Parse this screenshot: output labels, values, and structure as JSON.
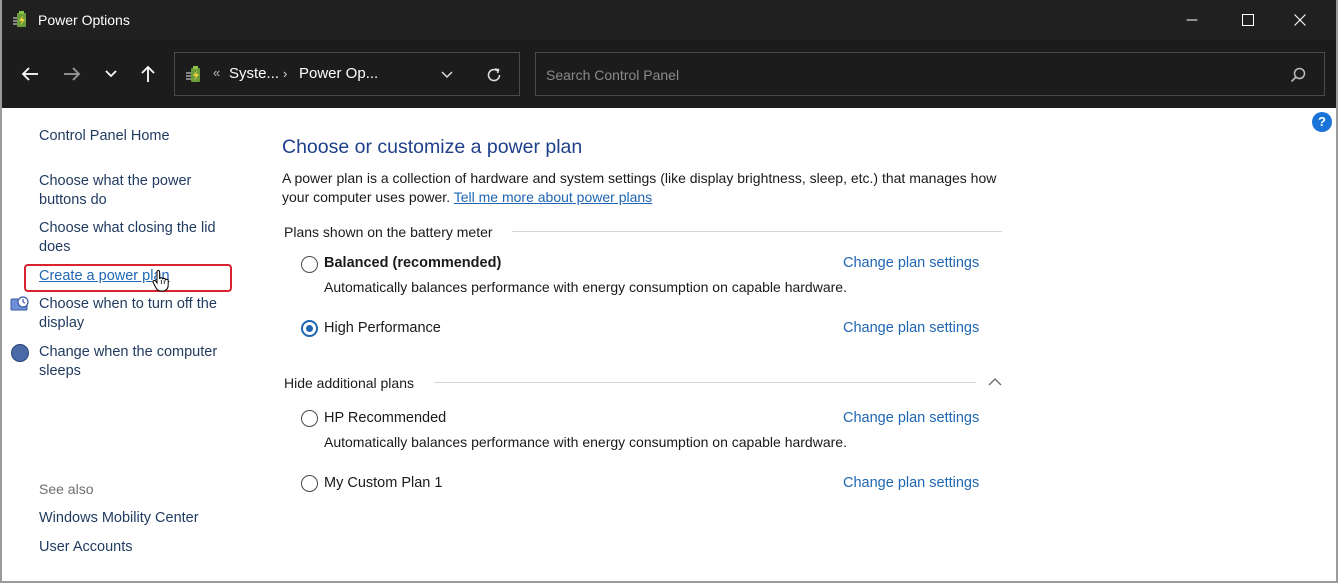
{
  "window": {
    "title": "Power Options"
  },
  "address_bar": {
    "overflow": "«",
    "crumbs": [
      "Syste...",
      "Power Op..."
    ],
    "separator": "›"
  },
  "search": {
    "placeholder": "Search Control Panel",
    "value": ""
  },
  "left_pane": {
    "home": "Control Panel Home",
    "links": {
      "power_buttons": "Choose what the power buttons do",
      "closing_lid": "Choose what closing the lid does",
      "create_plan": "Create a power plan",
      "turn_off_display": "Choose when to turn off the display",
      "computer_sleeps": "Change when the computer sleeps"
    },
    "see_also": {
      "label": "See also",
      "items": [
        "Windows Mobility Center",
        "User Accounts"
      ]
    }
  },
  "main": {
    "title": "Choose or customize a power plan",
    "description": "A power plan is a collection of hardware and system settings (like display brightness, sleep, etc.) that manages how your computer uses power.",
    "description_link": "Tell me more about power plans",
    "battery_section": "Plans shown on the battery meter",
    "hide_section": "Hide additional plans",
    "plans": [
      {
        "name": "Balanced (recommended)",
        "description": "Automatically balances performance with energy consumption on capable hardware.",
        "selected": false,
        "change": "Change plan settings"
      },
      {
        "name": "High Performance",
        "description": "",
        "selected": true,
        "change": "Change plan settings"
      },
      {
        "name": "HP Recommended",
        "description": "Automatically balances performance with energy consumption on capable hardware.",
        "selected": false,
        "change": "Change plan settings"
      },
      {
        "name": "My Custom Plan 1",
        "description": "",
        "selected": false,
        "change": "Change plan settings"
      }
    ]
  },
  "help": "?",
  "colors": {
    "titlebar": "#202020",
    "navbar": "#1c1c1c",
    "link": "#1f66b3",
    "heading": "#1e3f8a",
    "highlight": "#d9232d"
  }
}
